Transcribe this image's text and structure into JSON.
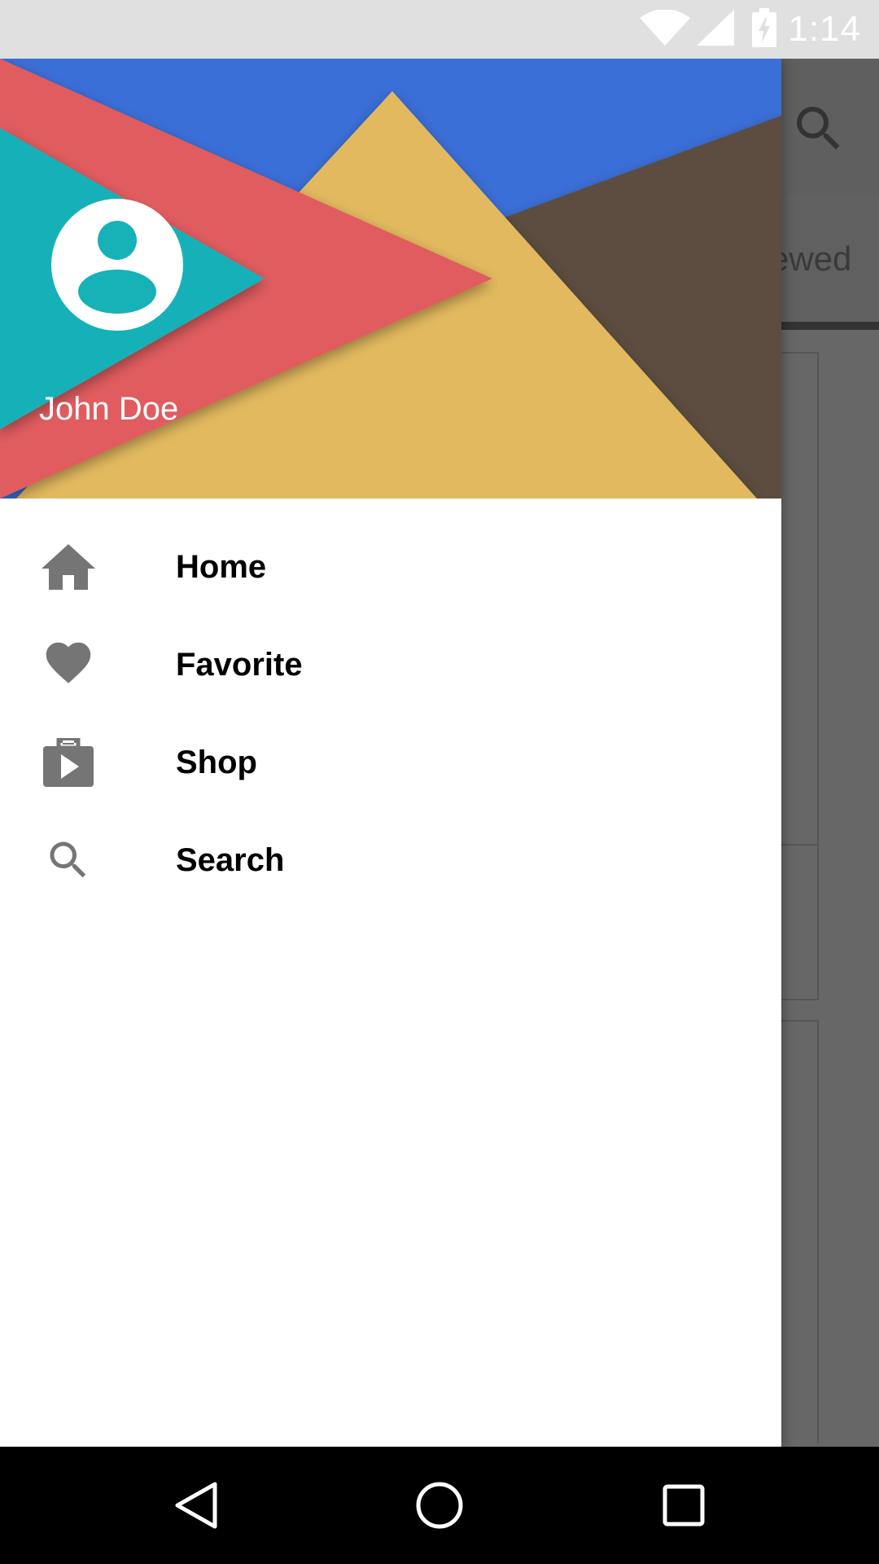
{
  "status_bar": {
    "time": "1:14",
    "icons": [
      "wifi-icon",
      "cell-signal-icon",
      "battery-charging-icon"
    ]
  },
  "app_behind": {
    "toolbar_icon": "search-icon",
    "tab_label_partial": "ewed"
  },
  "drawer": {
    "header": {
      "user_name": "John Doe",
      "avatar_icon": "account-circle-icon"
    },
    "items": [
      {
        "label": "Home",
        "icon": "home-icon"
      },
      {
        "label": "Favorite",
        "icon": "heart-icon"
      },
      {
        "label": "Shop",
        "icon": "shop-icon"
      },
      {
        "label": "Search",
        "icon": "search-icon"
      }
    ]
  },
  "nav_bar": {
    "buttons": [
      "back-icon",
      "home-circle-icon",
      "recents-icon"
    ]
  },
  "colors": {
    "header_blue": "#3b6fd8",
    "header_red": "#e05b5e",
    "header_teal": "#17b1b8",
    "header_yellow": "#e2b95f",
    "header_green": "#3f9c55",
    "header_brown": "#5c4d3f",
    "icon_gray": "#757575",
    "scrim": "#676767"
  }
}
